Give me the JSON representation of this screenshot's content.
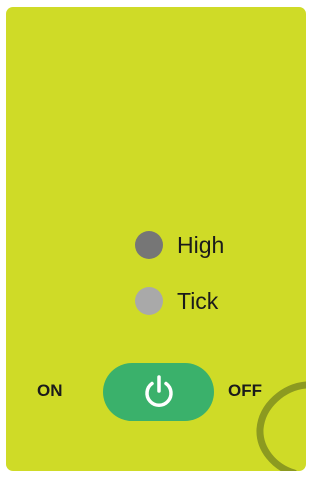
{
  "colors": {
    "panel_bg": "#cfdb27",
    "led_high": "#767676",
    "led_tick": "#a9a9a9",
    "power_button": "#3ab16b",
    "power_icon": "#ffffff",
    "dial_arc": "#8c9a20"
  },
  "indicators": [
    {
      "label": "High",
      "led_color": "#767676",
      "icon": "led-dot-icon"
    },
    {
      "label": "Tick",
      "led_color": "#a9a9a9",
      "icon": "led-dot-icon"
    }
  ],
  "power": {
    "on_label": "ON",
    "off_label": "OFF",
    "icon": "power-icon"
  }
}
